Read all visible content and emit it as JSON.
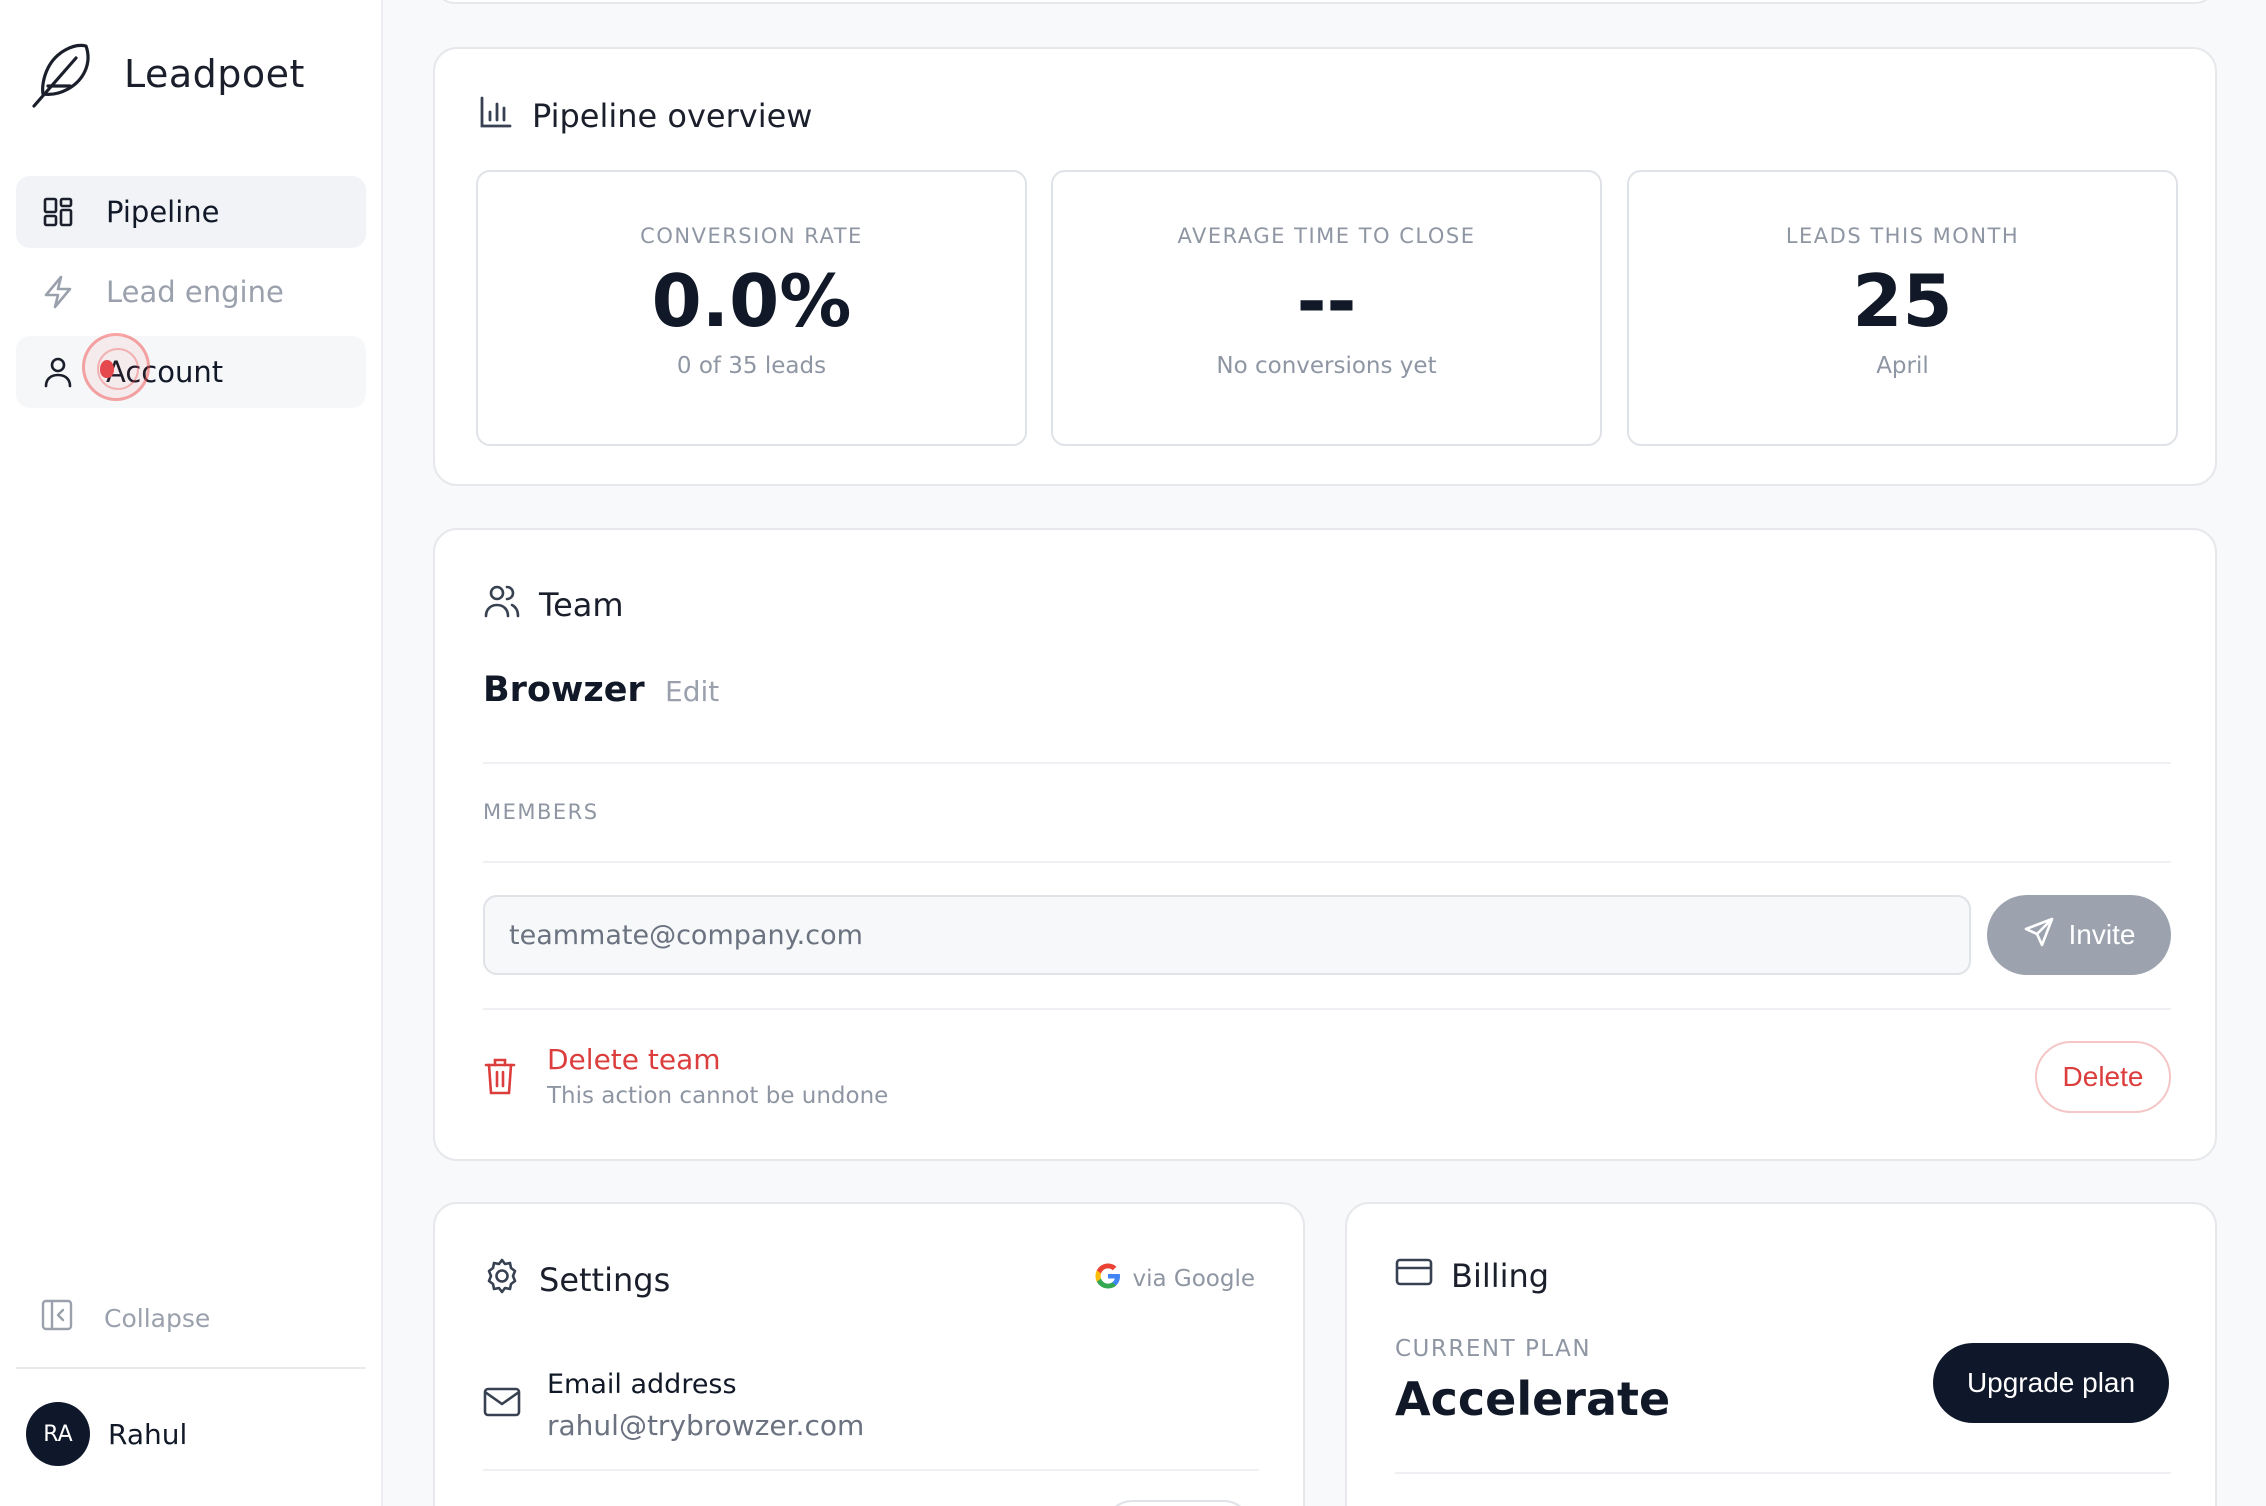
{
  "app": {
    "name": "Leadpoet"
  },
  "sidebar": {
    "items": [
      {
        "label": "Pipeline",
        "icon": "layout-grid-icon",
        "state": "active"
      },
      {
        "label": "Lead engine",
        "icon": "lightning-icon",
        "state": "muted"
      },
      {
        "label": "Account",
        "icon": "user-icon",
        "state": "hover"
      }
    ],
    "collapse_label": "Collapse",
    "user": {
      "initials": "RA",
      "name": "Rahul"
    }
  },
  "overview": {
    "title": "Pipeline overview",
    "stats": [
      {
        "label": "CONVERSION RATE",
        "value": "0.0%",
        "sub": "0 of 35 leads"
      },
      {
        "label": "AVERAGE TIME TO CLOSE",
        "value": "--",
        "sub": "No conversions yet"
      },
      {
        "label": "LEADS THIS MONTH",
        "value": "25",
        "sub": "April"
      }
    ]
  },
  "team": {
    "title": "Team",
    "name": "Browzer",
    "edit_label": "Edit",
    "members_label": "MEMBERS",
    "invite_placeholder": "teammate@company.com",
    "invite_label": "Invite",
    "delete_title": "Delete team",
    "delete_subtitle": "This action cannot be undone",
    "delete_label": "Delete"
  },
  "settings": {
    "title": "Settings",
    "provider_label": "via Google",
    "email_label": "Email address",
    "email_value": "rahul@trybrowzer.com"
  },
  "billing": {
    "title": "Billing",
    "plan_label": "CURRENT PLAN",
    "plan_name": "Accelerate",
    "upgrade_label": "Upgrade plan"
  },
  "colors": {
    "danger": "#dc3d3d",
    "primary_dark": "#0f172a",
    "muted_text": "#8f96a3",
    "disabled_button": "#9ca3af"
  }
}
